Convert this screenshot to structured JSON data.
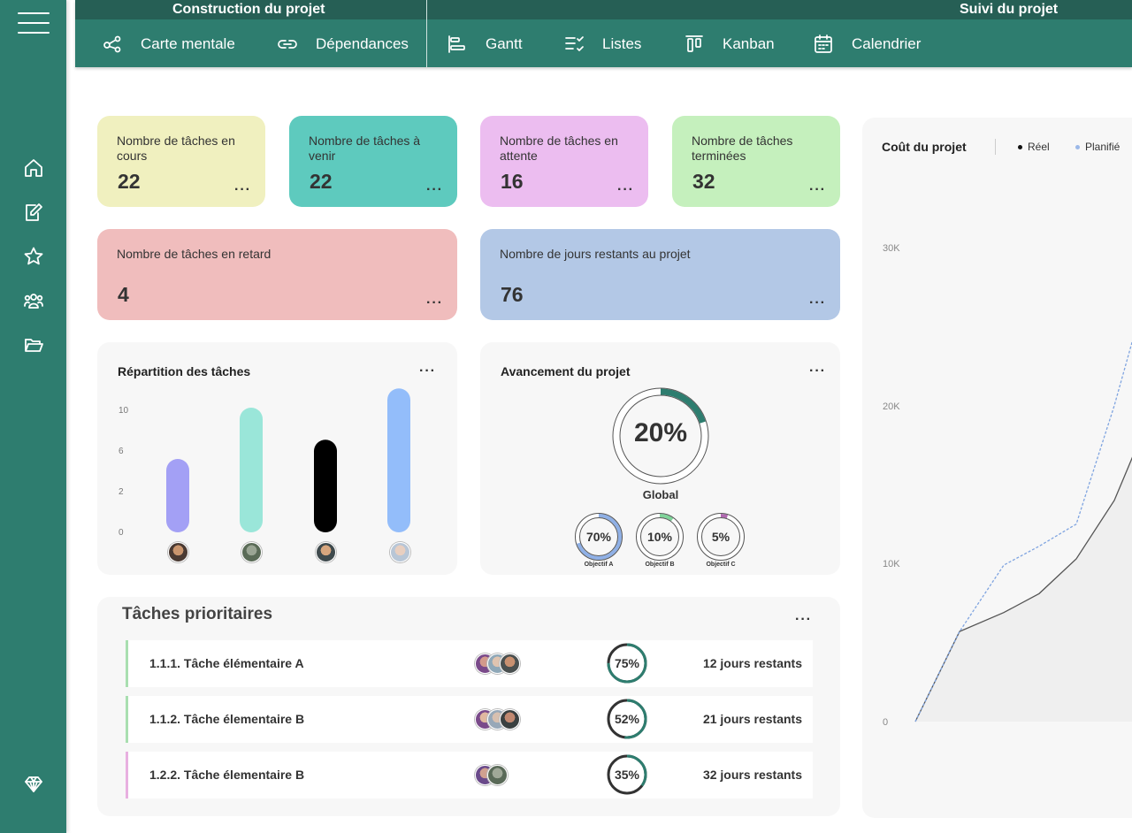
{
  "topbar": {
    "section_left": "Construction du projet",
    "section_right": "Suivi du projet",
    "items": [
      {
        "label": "Carte mentale",
        "icon": "mind-map-icon"
      },
      {
        "label": "Dépendances",
        "icon": "link-icon"
      },
      {
        "label": "Gantt",
        "icon": "gantt-icon"
      },
      {
        "label": "Listes",
        "icon": "checklist-icon"
      },
      {
        "label": "Kanban",
        "icon": "kanban-icon"
      },
      {
        "label": "Calendrier",
        "icon": "calendar-icon"
      }
    ]
  },
  "sidebar": {
    "icons": [
      "menu-icon",
      "home-icon",
      "edit-icon",
      "star-icon",
      "team-icon",
      "folder-icon",
      "diamond-icon"
    ]
  },
  "cards": [
    {
      "label": "Nombre de tâches en cours",
      "value": "22",
      "color": "#f0f0bf"
    },
    {
      "label": "Nombre de tâches à venir",
      "value": "22",
      "color": "#5ecabe"
    },
    {
      "label": "Nombre de tâches en attente",
      "value": "16",
      "color": "#ecbdf0"
    },
    {
      "label": "Nombre de tâches terminées",
      "value": "32",
      "color": "#c5f0bd"
    },
    {
      "label": "Nombre de tâches en retard",
      "value": "4",
      "color": "#f0bdbd"
    },
    {
      "label": "Nombre de jours restants au projet",
      "value": "76",
      "color": "#b3c8e6"
    }
  ],
  "repartition": {
    "title": "Répartition des tâches",
    "chart_data": {
      "type": "bar",
      "y_ticks": [
        "10",
        "6",
        "2",
        "0"
      ],
      "ylim": [
        0,
        12
      ],
      "values": [
        6,
        10,
        7.5,
        11.5
      ],
      "colors": [
        "#a3a0f5",
        "#9ae6d9",
        "#000000",
        "#93bdfa"
      ]
    }
  },
  "avancement": {
    "title": "Avancement du projet",
    "global": {
      "value": "20%",
      "label": "Global",
      "percent": 20
    },
    "objectives": [
      {
        "value": "70%",
        "label": "Objectif A",
        "percent": 70,
        "color": "#8fb0e6"
      },
      {
        "value": "10%",
        "label": "Objectif B",
        "percent": 10,
        "color": "#7fd49a"
      },
      {
        "value": "5%",
        "label": "Objectif C",
        "percent": 5,
        "color": "#b068b0"
      }
    ]
  },
  "priority": {
    "title": "Tâches prioritaires",
    "rows": [
      {
        "name": "1.1.1.  Tâche élémentaire A",
        "progress": "75%",
        "percent": 75,
        "days": "12 jours restants",
        "color": "#a9dfb0"
      },
      {
        "name": "1.1.2.  Tâche élementaire B",
        "progress": "52%",
        "percent": 52,
        "days": "21 jours restants",
        "color": "#a9dfb0"
      },
      {
        "name": "1.2.2. Tâche élementaire B",
        "progress": "35%",
        "percent": 35,
        "days": "32 jours restants",
        "color": "#e8b0e0"
      }
    ]
  },
  "cost": {
    "title": "Coût du projet",
    "legend": [
      {
        "label": "Réel",
        "color": "#111111"
      },
      {
        "label": "Planifié",
        "color": "#9bb8e8"
      }
    ],
    "chart_data": {
      "type": "line",
      "y_ticks": [
        "30K",
        "20K",
        "10K",
        "0"
      ],
      "ylim": [
        0,
        30000
      ],
      "series": [
        {
          "name": "Réel",
          "values": [
            0,
            5700,
            6900,
            8100,
            10300,
            14000
          ]
        },
        {
          "name": "Planifié",
          "values": [
            0,
            5700,
            9900,
            11100,
            12500,
            20000
          ]
        }
      ]
    }
  }
}
